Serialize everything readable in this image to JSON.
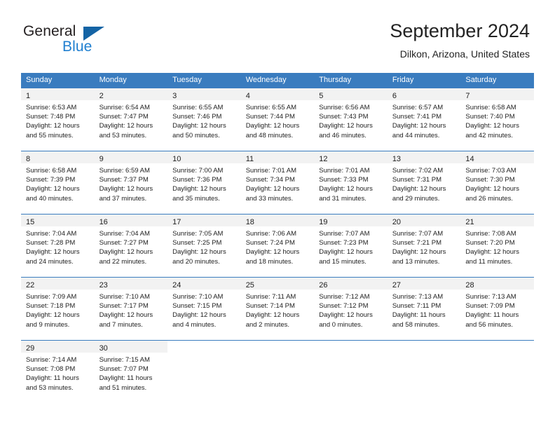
{
  "brand": {
    "name_part1": "General",
    "name_part2": "Blue",
    "triangle_color": "#1464a5",
    "blue_color": "#1f7fd0"
  },
  "header": {
    "title": "September 2024",
    "subtitle": "Dilkon, Arizona, United States"
  },
  "theme": {
    "header_bg": "#3a7cbf",
    "daynum_band": "#f2f2f2",
    "grid_line": "#3a7cbf"
  },
  "weekdays": [
    "Sunday",
    "Monday",
    "Tuesday",
    "Wednesday",
    "Thursday",
    "Friday",
    "Saturday"
  ],
  "weeks": [
    [
      {
        "day": "1",
        "sunrise": "Sunrise: 6:53 AM",
        "sunset": "Sunset: 7:48 PM",
        "daylight1": "Daylight: 12 hours",
        "daylight2": "and 55 minutes."
      },
      {
        "day": "2",
        "sunrise": "Sunrise: 6:54 AM",
        "sunset": "Sunset: 7:47 PM",
        "daylight1": "Daylight: 12 hours",
        "daylight2": "and 53 minutes."
      },
      {
        "day": "3",
        "sunrise": "Sunrise: 6:55 AM",
        "sunset": "Sunset: 7:46 PM",
        "daylight1": "Daylight: 12 hours",
        "daylight2": "and 50 minutes."
      },
      {
        "day": "4",
        "sunrise": "Sunrise: 6:55 AM",
        "sunset": "Sunset: 7:44 PM",
        "daylight1": "Daylight: 12 hours",
        "daylight2": "and 48 minutes."
      },
      {
        "day": "5",
        "sunrise": "Sunrise: 6:56 AM",
        "sunset": "Sunset: 7:43 PM",
        "daylight1": "Daylight: 12 hours",
        "daylight2": "and 46 minutes."
      },
      {
        "day": "6",
        "sunrise": "Sunrise: 6:57 AM",
        "sunset": "Sunset: 7:41 PM",
        "daylight1": "Daylight: 12 hours",
        "daylight2": "and 44 minutes."
      },
      {
        "day": "7",
        "sunrise": "Sunrise: 6:58 AM",
        "sunset": "Sunset: 7:40 PM",
        "daylight1": "Daylight: 12 hours",
        "daylight2": "and 42 minutes."
      }
    ],
    [
      {
        "day": "8",
        "sunrise": "Sunrise: 6:58 AM",
        "sunset": "Sunset: 7:39 PM",
        "daylight1": "Daylight: 12 hours",
        "daylight2": "and 40 minutes."
      },
      {
        "day": "9",
        "sunrise": "Sunrise: 6:59 AM",
        "sunset": "Sunset: 7:37 PM",
        "daylight1": "Daylight: 12 hours",
        "daylight2": "and 37 minutes."
      },
      {
        "day": "10",
        "sunrise": "Sunrise: 7:00 AM",
        "sunset": "Sunset: 7:36 PM",
        "daylight1": "Daylight: 12 hours",
        "daylight2": "and 35 minutes."
      },
      {
        "day": "11",
        "sunrise": "Sunrise: 7:01 AM",
        "sunset": "Sunset: 7:34 PM",
        "daylight1": "Daylight: 12 hours",
        "daylight2": "and 33 minutes."
      },
      {
        "day": "12",
        "sunrise": "Sunrise: 7:01 AM",
        "sunset": "Sunset: 7:33 PM",
        "daylight1": "Daylight: 12 hours",
        "daylight2": "and 31 minutes."
      },
      {
        "day": "13",
        "sunrise": "Sunrise: 7:02 AM",
        "sunset": "Sunset: 7:31 PM",
        "daylight1": "Daylight: 12 hours",
        "daylight2": "and 29 minutes."
      },
      {
        "day": "14",
        "sunrise": "Sunrise: 7:03 AM",
        "sunset": "Sunset: 7:30 PM",
        "daylight1": "Daylight: 12 hours",
        "daylight2": "and 26 minutes."
      }
    ],
    [
      {
        "day": "15",
        "sunrise": "Sunrise: 7:04 AM",
        "sunset": "Sunset: 7:28 PM",
        "daylight1": "Daylight: 12 hours",
        "daylight2": "and 24 minutes."
      },
      {
        "day": "16",
        "sunrise": "Sunrise: 7:04 AM",
        "sunset": "Sunset: 7:27 PM",
        "daylight1": "Daylight: 12 hours",
        "daylight2": "and 22 minutes."
      },
      {
        "day": "17",
        "sunrise": "Sunrise: 7:05 AM",
        "sunset": "Sunset: 7:25 PM",
        "daylight1": "Daylight: 12 hours",
        "daylight2": "and 20 minutes."
      },
      {
        "day": "18",
        "sunrise": "Sunrise: 7:06 AM",
        "sunset": "Sunset: 7:24 PM",
        "daylight1": "Daylight: 12 hours",
        "daylight2": "and 18 minutes."
      },
      {
        "day": "19",
        "sunrise": "Sunrise: 7:07 AM",
        "sunset": "Sunset: 7:23 PM",
        "daylight1": "Daylight: 12 hours",
        "daylight2": "and 15 minutes."
      },
      {
        "day": "20",
        "sunrise": "Sunrise: 7:07 AM",
        "sunset": "Sunset: 7:21 PM",
        "daylight1": "Daylight: 12 hours",
        "daylight2": "and 13 minutes."
      },
      {
        "day": "21",
        "sunrise": "Sunrise: 7:08 AM",
        "sunset": "Sunset: 7:20 PM",
        "daylight1": "Daylight: 12 hours",
        "daylight2": "and 11 minutes."
      }
    ],
    [
      {
        "day": "22",
        "sunrise": "Sunrise: 7:09 AM",
        "sunset": "Sunset: 7:18 PM",
        "daylight1": "Daylight: 12 hours",
        "daylight2": "and 9 minutes."
      },
      {
        "day": "23",
        "sunrise": "Sunrise: 7:10 AM",
        "sunset": "Sunset: 7:17 PM",
        "daylight1": "Daylight: 12 hours",
        "daylight2": "and 7 minutes."
      },
      {
        "day": "24",
        "sunrise": "Sunrise: 7:10 AM",
        "sunset": "Sunset: 7:15 PM",
        "daylight1": "Daylight: 12 hours",
        "daylight2": "and 4 minutes."
      },
      {
        "day": "25",
        "sunrise": "Sunrise: 7:11 AM",
        "sunset": "Sunset: 7:14 PM",
        "daylight1": "Daylight: 12 hours",
        "daylight2": "and 2 minutes."
      },
      {
        "day": "26",
        "sunrise": "Sunrise: 7:12 AM",
        "sunset": "Sunset: 7:12 PM",
        "daylight1": "Daylight: 12 hours",
        "daylight2": "and 0 minutes."
      },
      {
        "day": "27",
        "sunrise": "Sunrise: 7:13 AM",
        "sunset": "Sunset: 7:11 PM",
        "daylight1": "Daylight: 11 hours",
        "daylight2": "and 58 minutes."
      },
      {
        "day": "28",
        "sunrise": "Sunrise: 7:13 AM",
        "sunset": "Sunset: 7:09 PM",
        "daylight1": "Daylight: 11 hours",
        "daylight2": "and 56 minutes."
      }
    ],
    [
      {
        "day": "29",
        "sunrise": "Sunrise: 7:14 AM",
        "sunset": "Sunset: 7:08 PM",
        "daylight1": "Daylight: 11 hours",
        "daylight2": "and 53 minutes."
      },
      {
        "day": "30",
        "sunrise": "Sunrise: 7:15 AM",
        "sunset": "Sunset: 7:07 PM",
        "daylight1": "Daylight: 11 hours",
        "daylight2": "and 51 minutes."
      },
      {
        "day": "",
        "sunrise": "",
        "sunset": "",
        "daylight1": "",
        "daylight2": ""
      },
      {
        "day": "",
        "sunrise": "",
        "sunset": "",
        "daylight1": "",
        "daylight2": ""
      },
      {
        "day": "",
        "sunrise": "",
        "sunset": "",
        "daylight1": "",
        "daylight2": ""
      },
      {
        "day": "",
        "sunrise": "",
        "sunset": "",
        "daylight1": "",
        "daylight2": ""
      },
      {
        "day": "",
        "sunrise": "",
        "sunset": "",
        "daylight1": "",
        "daylight2": ""
      }
    ]
  ]
}
